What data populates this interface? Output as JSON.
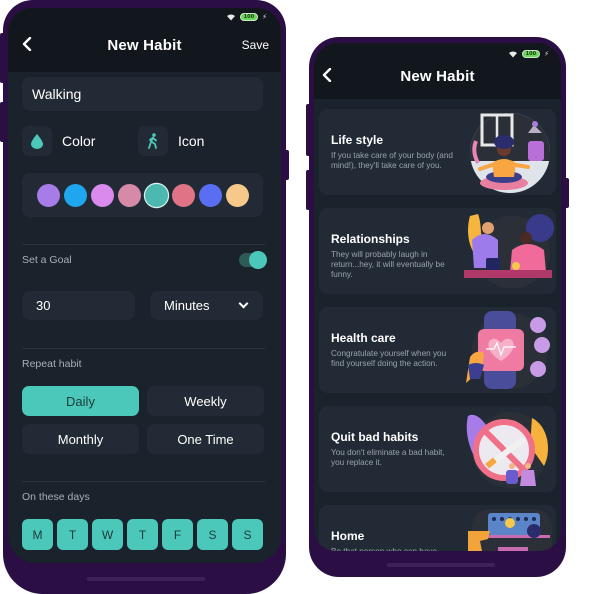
{
  "left_screen": {
    "header": {
      "title": "New Habit",
      "back_icon": "chevron-left-icon",
      "save_label": "Save"
    },
    "status": {
      "battery": "100"
    },
    "habit_name": {
      "value": "Walking",
      "placeholder": ""
    },
    "color_picker": {
      "label": "Color",
      "icon": "droplet-icon"
    },
    "icon_picker": {
      "label": "Icon",
      "icon": "walking-person-icon"
    },
    "swatches": [
      {
        "color": "#a77be8",
        "selected": false
      },
      {
        "color": "#1fa6ee",
        "selected": false
      },
      {
        "color": "#d98aec",
        "selected": false
      },
      {
        "color": "#d58aa8",
        "selected": false
      },
      {
        "color": "#4cb8b0",
        "selected": true
      },
      {
        "color": "#e07486",
        "selected": false
      },
      {
        "color": "#5a6ef3",
        "selected": false
      },
      {
        "color": "#f6c98a",
        "selected": false
      }
    ],
    "goal": {
      "label": "Set a Goal",
      "enabled": true,
      "amount": "30",
      "unit": "Minutes"
    },
    "repeat": {
      "label": "Repeat habit",
      "options": [
        {
          "label": "Daily",
          "active": true
        },
        {
          "label": "Weekly",
          "active": false
        },
        {
          "label": "Monthly",
          "active": false
        },
        {
          "label": "One Time",
          "active": false
        }
      ]
    },
    "days": {
      "label": "On these days",
      "items": [
        {
          "label": "M",
          "selected": true
        },
        {
          "label": "T",
          "selected": true
        },
        {
          "label": "W",
          "selected": true
        },
        {
          "label": "T",
          "selected": true
        },
        {
          "label": "F",
          "selected": true
        },
        {
          "label": "S",
          "selected": true
        },
        {
          "label": "S",
          "selected": true
        }
      ]
    }
  },
  "right_screen": {
    "header": {
      "title": "New Habit",
      "back_icon": "chevron-left-icon"
    },
    "status": {
      "battery": "100"
    },
    "categories": [
      {
        "title": "Life style",
        "description": "If you take care of your body (and mind!), they'll take care of you.",
        "illustration": "meditation-illustration"
      },
      {
        "title": "Relationships",
        "description": "They will probably laugh in return...hey, it will eventually be funny.",
        "illustration": "couple-cooking-illustration"
      },
      {
        "title": "Health care",
        "description": "Congratulate yourself when you find yourself doing the action.",
        "illustration": "smartwatch-heart-illustration"
      },
      {
        "title": "Quit bad habits",
        "description": "You don't eliminate a bad habit, you replace it.",
        "illustration": "no-smoking-illustration"
      },
      {
        "title": "Home",
        "description": "Be that person who can have",
        "illustration": "cleaning-illustration"
      }
    ]
  },
  "theme": {
    "accent": "#4cc8bb",
    "frame": "#2b0f44",
    "screen_bg": "#1a222b",
    "card_bg": "#222b35"
  }
}
